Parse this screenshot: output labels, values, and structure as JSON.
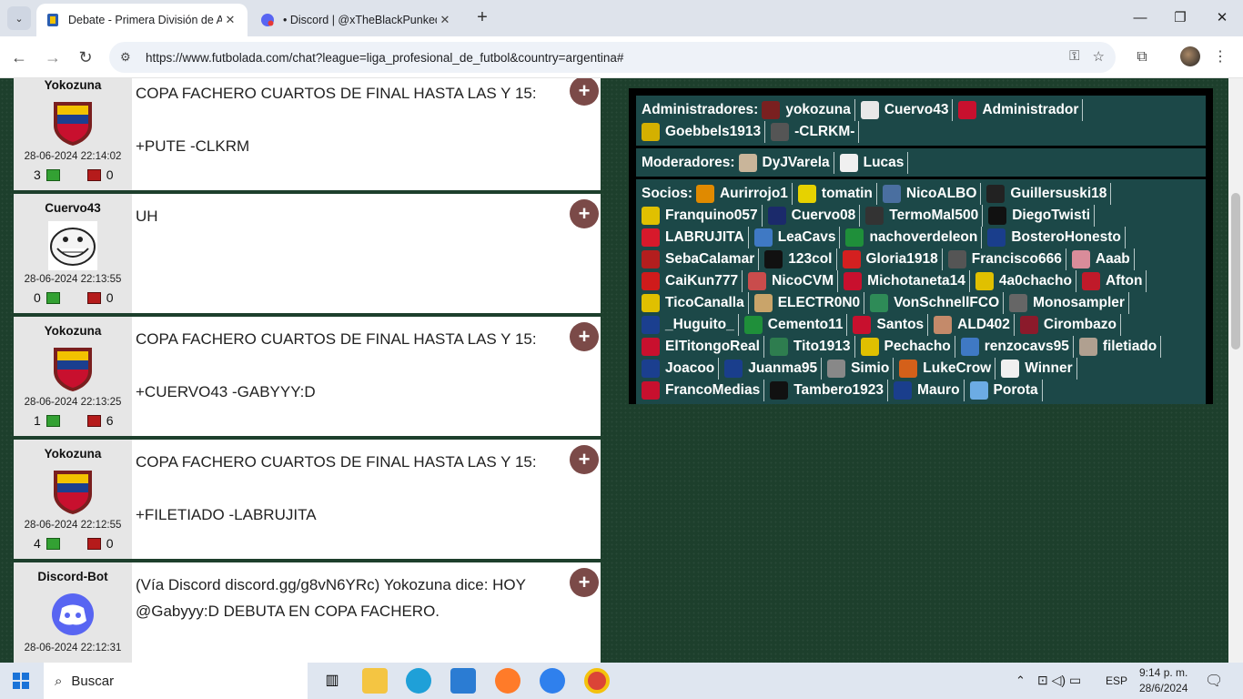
{
  "browser": {
    "tabs": [
      {
        "title": "Debate - Primera División de Ar",
        "close": "✕"
      },
      {
        "title": "• Discord | @xTheBlackPunkedx",
        "close": "✕"
      }
    ],
    "new_tab": "+",
    "url": "https://www.futbolada.com/chat?league=liga_profesional_de_futbol&country=argentina#",
    "window_controls": {
      "minimize": "—",
      "maximize": "❐",
      "close": "✕"
    }
  },
  "posts": [
    {
      "user": "Yokozuna",
      "avatar": "venezuela-shield",
      "date": "28-06-2024 22:14:02",
      "up": "3",
      "down": "0",
      "lines": [
        "COPA FACHERO CUARTOS DE FINAL HASTA LAS Y 15:",
        "",
        "+PUTE -CLKRM"
      ]
    },
    {
      "user": "Cuervo43",
      "avatar": "trollface",
      "date": "28-06-2024 22:13:55",
      "up": "0",
      "down": "0",
      "lines": [
        "UH"
      ]
    },
    {
      "user": "Yokozuna",
      "avatar": "venezuela-shield",
      "date": "28-06-2024 22:13:25",
      "up": "1",
      "down": "6",
      "lines": [
        "COPA FACHERO CUARTOS DE FINAL HASTA LAS Y 15:",
        "",
        "+CUERVO43 -GABYYY:D"
      ]
    },
    {
      "user": "Yokozuna",
      "avatar": "venezuela-shield",
      "date": "28-06-2024 22:12:55",
      "up": "4",
      "down": "0",
      "lines": [
        "COPA FACHERO CUARTOS DE FINAL HASTA LAS Y 15:",
        "",
        "+FILETIADO -LABRUJITA"
      ]
    },
    {
      "user": "Discord-Bot",
      "avatar": "discord-logo",
      "date": "28-06-2024 22:12:31",
      "up": "",
      "down": "",
      "lines": [
        "(Vía Discord discord.gg/g8vN6YRc) Yokozuna dice: HOY @Gabyyy:D DEBUTA EN COPA FACHERO."
      ]
    }
  ],
  "plus_label": "+",
  "users_panel": {
    "admins_label": "Administradores:",
    "admins": [
      {
        "name": "yokozuna",
        "color": "#7a2020"
      },
      {
        "name": "Cuervo43",
        "color": "#e8e8e8"
      },
      {
        "name": "Administrador",
        "color": "#c8102e"
      },
      {
        "name": "Goebbels1913",
        "color": "#d4b000"
      },
      {
        "name": "-CLRKM-",
        "color": "#555555"
      }
    ],
    "mods_label": "Moderadores:",
    "mods": [
      {
        "name": "DyJVarela",
        "color": "#c9b59a"
      },
      {
        "name": "Lucas",
        "color": "#f0f0f0"
      }
    ],
    "members_label": "Socios:",
    "members": [
      {
        "name": "Aurirrojo1",
        "color": "#e08a00"
      },
      {
        "name": "tomatin",
        "color": "#e6d200"
      },
      {
        "name": "NicoALBO",
        "color": "#4a6fa0"
      },
      {
        "name": "Guillersuski18",
        "color": "#222222"
      },
      {
        "name": "Franquino057",
        "color": "#e0c000"
      },
      {
        "name": "Cuervo08",
        "color": "#1b2a6b"
      },
      {
        "name": "TermoMal500",
        "color": "#333333"
      },
      {
        "name": "DiegoTwisti",
        "color": "#111111"
      },
      {
        "name": "LABRUJITA",
        "color": "#d7192b"
      },
      {
        "name": "LeaCavs",
        "color": "#3f79c4"
      },
      {
        "name": "nachoverdeleon",
        "color": "#1f8f3a"
      },
      {
        "name": "BosteroHonesto",
        "color": "#1a3e8c"
      },
      {
        "name": "SebaCalamar",
        "color": "#b31e1e"
      },
      {
        "name": "123col",
        "color": "#111111"
      },
      {
        "name": "Gloria1918",
        "color": "#d42020"
      },
      {
        "name": "Francisco666",
        "color": "#555555"
      },
      {
        "name": "Aaab",
        "color": "#d98c9a"
      },
      {
        "name": "CaiKun777",
        "color": "#cf1b1b"
      },
      {
        "name": "NicoCVM",
        "color": "#c94c4c"
      },
      {
        "name": "Michotaneta14",
        "color": "#c8102e"
      },
      {
        "name": "4a0chacho",
        "color": "#e0c000"
      },
      {
        "name": "Afton",
        "color": "#c01a2a"
      },
      {
        "name": "TicoCanalla",
        "color": "#e0c000"
      },
      {
        "name": "ELECTR0N0",
        "color": "#c9a46a"
      },
      {
        "name": "VonSchnellFCO",
        "color": "#2e8b57"
      },
      {
        "name": "Monosampler",
        "color": "#666666"
      },
      {
        "name": "_Huguito_",
        "color": "#1b3f8f"
      },
      {
        "name": "Cemento11",
        "color": "#1f8f3a"
      },
      {
        "name": "Santos",
        "color": "#c8102e"
      },
      {
        "name": "ALD402",
        "color": "#c48a6a"
      },
      {
        "name": "Cirombazo",
        "color": "#8b1a2b"
      },
      {
        "name": "ElTitongoReal",
        "color": "#c8102e"
      },
      {
        "name": "Tito1913",
        "color": "#2e7d4f"
      },
      {
        "name": "Pechacho",
        "color": "#e0c000"
      },
      {
        "name": "renzocavs95",
        "color": "#3f79c4"
      },
      {
        "name": "filetiado",
        "color": "#b0a090"
      },
      {
        "name": "Joacoo",
        "color": "#1b3f8f"
      },
      {
        "name": "Juanma95",
        "color": "#1a3e8c"
      },
      {
        "name": "Simio",
        "color": "#888888"
      },
      {
        "name": "LukeCrow",
        "color": "#d4601a"
      },
      {
        "name": "Winner",
        "color": "#f0f0f0"
      },
      {
        "name": "FrancoMedias",
        "color": "#c8102e"
      },
      {
        "name": "Tambero1923",
        "color": "#111111"
      },
      {
        "name": "Mauro",
        "color": "#1a3e8c"
      },
      {
        "name": "Porota",
        "color": "#6cace4"
      }
    ]
  },
  "taskbar": {
    "search": "Buscar",
    "lang": "ESP",
    "time": "9:14 p. m.",
    "date": "28/6/2024"
  }
}
